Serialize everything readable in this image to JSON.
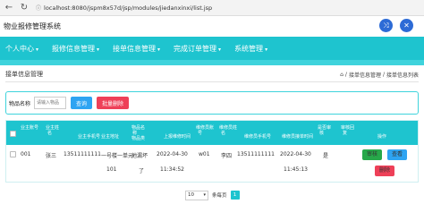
{
  "browser": {
    "back_icon": "arrow-left-icon",
    "refresh_icon": "refresh-icon",
    "url": "localhost:8080/jspm8x57d/jsp/modules/jiedanxinxi/list.jsp"
  },
  "header": {
    "site_title": "物业报修管理系统",
    "icons": [
      "shuffle-icon",
      "close-icon"
    ],
    "icon_color": "#2d6bd6"
  },
  "nav": {
    "bg_color": "#1ec4cf",
    "items": [
      {
        "label": "个人中心"
      },
      {
        "label": "报修信息管理"
      },
      {
        "label": "接单信息管理"
      },
      {
        "label": "完成订单管理"
      },
      {
        "label": "系统管理"
      }
    ]
  },
  "page": {
    "title": "接单信息管理",
    "breadcrumb": [
      "接单信息管理",
      "接单信息列表"
    ]
  },
  "search": {
    "label": "物品名称",
    "placeholder": "请输入物品",
    "search_button": "查询",
    "batch_delete_button": "批量删除"
  },
  "table": {
    "headers_line1": [
      "业主账号",
      "业主姓",
      "物品名",
      "维修员账",
      "维修员姓",
      "是否审",
      "审核回"
    ],
    "headers_line2": [
      "业主手机号",
      "业主地址",
      "物品类",
      "上报维修时间",
      "维修员手机号",
      "维修员接单时间",
      "操作"
    ],
    "headers_line3": [
      "名",
      "称",
      "号",
      "名",
      "核",
      "复"
    ],
    "row": {
      "account": "001",
      "name": "张三",
      "phone": "13511111111",
      "address": "一号楼一单元",
      "address_extra": "101",
      "item_type": "地漏坏",
      "item_extra": "了",
      "report_time": "2022-04-30",
      "report_time_extra": "11:34:52",
      "repairer_account": "w01",
      "repairer_name": "李四",
      "repairer_phone": "13511111111",
      "accept_time": "2022-04-30",
      "accept_time_extra": "11:45:13",
      "approved": "是"
    },
    "actions": {
      "approve": "审核",
      "view": "查看",
      "delete": "删除"
    }
  },
  "pagination": {
    "page_size": "10",
    "goto_label": "条每页",
    "current_page": "1"
  }
}
